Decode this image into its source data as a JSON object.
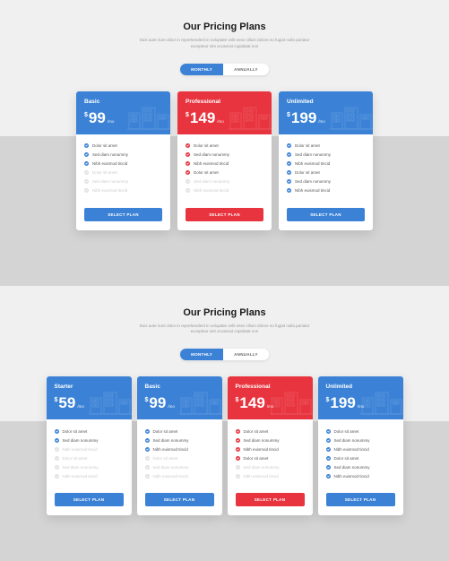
{
  "sections": [
    {
      "title": "Our Pricing Plans",
      "subtitle": "Duis aute irure dolor in reprehenderit in voluptate velit esse cillum dolore eu fugiat nulla pariatur excepteur sint occaecat cupidatat non",
      "toggle": {
        "monthly": "MONTHLY",
        "annually": "ANNUALLY"
      },
      "plans": [
        {
          "name": "Basic",
          "color": "blue",
          "currency": "$",
          "price": "99",
          "period": "/mo",
          "features": [
            {
              "label": "Dolor sit amet",
              "on": true
            },
            {
              "label": "Sed diam nonummy",
              "on": true
            },
            {
              "label": "Nibh euismod tincid",
              "on": true
            },
            {
              "label": "Dolor sit amet",
              "on": false
            },
            {
              "label": "Sed diam nonummy",
              "on": false
            },
            {
              "label": "Nibh euismod tincid",
              "on": false
            }
          ],
          "cta": "SELECT PLAN"
        },
        {
          "name": "Professional",
          "color": "red",
          "currency": "$",
          "price": "149",
          "period": "/mo",
          "features": [
            {
              "label": "Dolor sit amet",
              "on": true
            },
            {
              "label": "Sed diam nonummy",
              "on": true
            },
            {
              "label": "Nibh euismod tincid",
              "on": true
            },
            {
              "label": "Dolor sit amet",
              "on": true
            },
            {
              "label": "Sed diam nonummy",
              "on": false
            },
            {
              "label": "Nibh euismod tincid",
              "on": false
            }
          ],
          "cta": "SELECT PLAN"
        },
        {
          "name": "Unlimited",
          "color": "blue",
          "currency": "$",
          "price": "199",
          "period": "/mo",
          "features": [
            {
              "label": "Dolor sit amet",
              "on": true
            },
            {
              "label": "Sed diam nonummy",
              "on": true
            },
            {
              "label": "Nibh euismod tincid",
              "on": true
            },
            {
              "label": "Dolor sit amet",
              "on": true
            },
            {
              "label": "Sed diam nonummy",
              "on": true
            },
            {
              "label": "Nibh euismod tincid",
              "on": true
            }
          ],
          "cta": "SELECT PLAN"
        }
      ]
    },
    {
      "title": "Our Pricing Plans",
      "subtitle": "Duis aute irure dolor in reprehenderit in voluptate velit esse cillum dolore eu fugiat nulla pariatur excepteur sint occaecat cupidatat non",
      "toggle": {
        "monthly": "MONTHLY",
        "annually": "ANNUALLY"
      },
      "plans": [
        {
          "name": "Starter",
          "color": "blue",
          "currency": "$",
          "price": "59",
          "period": "/mo",
          "features": [
            {
              "label": "Dolor sit amet",
              "on": true
            },
            {
              "label": "Sed diam nonummy",
              "on": true
            },
            {
              "label": "Nibh euismod tincid",
              "on": false
            },
            {
              "label": "Dolor sit amet",
              "on": false
            },
            {
              "label": "Sed diam nonummy",
              "on": false
            },
            {
              "label": "Nibh euismod tincid",
              "on": false
            }
          ],
          "cta": "SELECT PLAN"
        },
        {
          "name": "Basic",
          "color": "blue",
          "currency": "$",
          "price": "99",
          "period": "/mo",
          "features": [
            {
              "label": "Dolor sit amet",
              "on": true
            },
            {
              "label": "Sed diam nonummy",
              "on": true
            },
            {
              "label": "Nibh euismod tincid",
              "on": true
            },
            {
              "label": "Dolor sit amet",
              "on": false
            },
            {
              "label": "Sed diam nonummy",
              "on": false
            },
            {
              "label": "Nibh euismod tincid",
              "on": false
            }
          ],
          "cta": "SELECT PLAN"
        },
        {
          "name": "Professional",
          "color": "red",
          "currency": "$",
          "price": "149",
          "period": "/mo",
          "features": [
            {
              "label": "Dolor sit amet",
              "on": true
            },
            {
              "label": "Sed diam nonummy",
              "on": true
            },
            {
              "label": "Nibh euismod tincid",
              "on": true
            },
            {
              "label": "Dolor sit amet",
              "on": true
            },
            {
              "label": "Sed diam nonummy",
              "on": false
            },
            {
              "label": "Nibh euismod tincid",
              "on": false
            }
          ],
          "cta": "SELECT PLAN"
        },
        {
          "name": "Unlimited",
          "color": "blue",
          "currency": "$",
          "price": "199",
          "period": "/mo",
          "features": [
            {
              "label": "Dolor sit amet",
              "on": true
            },
            {
              "label": "Sed diam nonummy",
              "on": true
            },
            {
              "label": "Nibh euismod tincid",
              "on": true
            },
            {
              "label": "Dolor sit amet",
              "on": true
            },
            {
              "label": "Sed diam nonummy",
              "on": true
            },
            {
              "label": "Nibh euismod tincid",
              "on": true
            }
          ],
          "cta": "SELECT PLAN"
        }
      ]
    }
  ]
}
